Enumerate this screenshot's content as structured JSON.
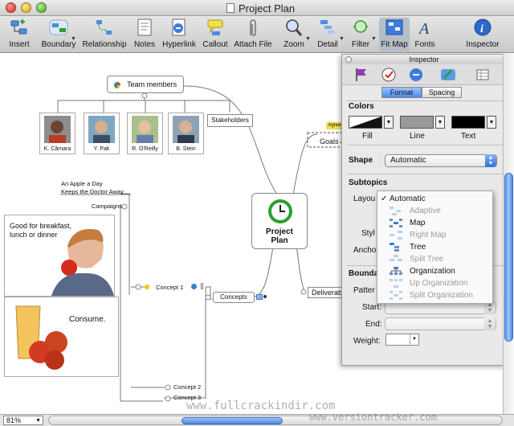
{
  "window": {
    "title": "Project Plan"
  },
  "toolbar": {
    "items": [
      {
        "label": "Insert",
        "icon": "insert-topic-icon"
      },
      {
        "label": "Boundary",
        "icon": "boundary-icon"
      },
      {
        "label": "Relationship",
        "icon": "relationship-icon"
      },
      {
        "label": "Notes",
        "icon": "notes-icon"
      },
      {
        "label": "Hyperlink",
        "icon": "hyperlink-icon"
      },
      {
        "label": "Callout",
        "icon": "callout-icon"
      },
      {
        "label": "Attach File",
        "icon": "paperclip-icon"
      },
      {
        "label": "Zoom",
        "icon": "magnifier-icon"
      },
      {
        "label": "Detail",
        "icon": "detail-icon"
      },
      {
        "label": "Filter",
        "icon": "filter-icon"
      },
      {
        "label": "Fit Map",
        "icon": "fit-map-icon"
      },
      {
        "label": "Fonts",
        "icon": "fonts-icon"
      },
      {
        "label": "Inspector",
        "icon": "inspector-info-icon"
      }
    ]
  },
  "map": {
    "central_topic": "Project Plan",
    "team_members": "Team members",
    "people": [
      "K. Câmara",
      "Y. Pak",
      "R. O'Reilly",
      "B. Stein"
    ],
    "stakeholders": "Stakeholders",
    "apple_note_line1": "An Apple a Day",
    "apple_note_line2": "Keeps the Doctor Away",
    "campaigns": "Campaigns",
    "breakfast_line1": "Good for breakfast,",
    "breakfast_line2": "lunch or dinner",
    "consume": "Consume.",
    "concept1": "Concept 1",
    "concept2": "Concept 2",
    "concept3": "Concept 3",
    "concepts": "Concepts",
    "goals": "Goals &",
    "deliverables": "Deliverab",
    "agreed_tag": "Agreed"
  },
  "inspector": {
    "title": "Inspector",
    "tabs": [
      "Format",
      "Spacing"
    ],
    "colors_header": "Colors",
    "fill_label": "Fill",
    "line_label": "Line",
    "text_label": "Text",
    "shape_header": "Shape",
    "shape_value": "Automatic",
    "subtopics_header": "Subtopics",
    "layout_label": "Layou",
    "style_label": "Styl",
    "anchor_label": "Ancho",
    "boundary_header": "Bounda",
    "pattern_label": "Patter",
    "start_label": "Start:",
    "end_label": "End:",
    "weight_label": "Weight:"
  },
  "layout_menu": {
    "items": [
      {
        "label": "Automatic",
        "enabled": true,
        "checked": true
      },
      {
        "label": "Adaptive",
        "enabled": false
      },
      {
        "label": "Map",
        "enabled": true
      },
      {
        "label": "Right Map",
        "enabled": false
      },
      {
        "label": "Tree",
        "enabled": true
      },
      {
        "label": "Split Tree",
        "enabled": false
      },
      {
        "label": "Organization",
        "enabled": true
      },
      {
        "label": "Up Organization",
        "enabled": false
      },
      {
        "label": "Split Organization",
        "enabled": false
      }
    ],
    "check_mark": "✓"
  },
  "status": {
    "zoom": "81%"
  },
  "watermarks": [
    "www.fullcrackindir.com",
    "www.versiontracker.com"
  ],
  "colors": {
    "accent": "#3b7ddd",
    "central_green": "#2e9e2e",
    "menu_disabled": "#9a9a9a"
  }
}
